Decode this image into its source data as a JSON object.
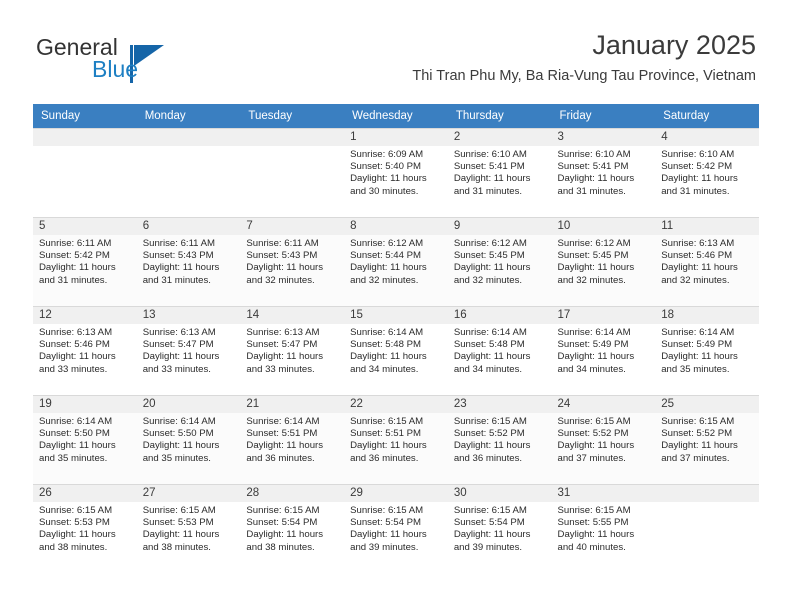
{
  "brand": {
    "name_part1": "General",
    "name_part2": "Blue",
    "logo_icon": "triangle-flag-icon"
  },
  "header": {
    "month_title": "January 2025",
    "location": "Thi Tran Phu My, Ba Ria-Vung Tau Province, Vietnam"
  },
  "theme": {
    "header_bg": "#3a7fc1",
    "header_text": "#ffffff",
    "daynum_band_bg": "#f0f0f0",
    "row_alt_bg": "#fbfbfb",
    "grid_line": "#d9d9d9",
    "brand_blue": "#1d7fc3"
  },
  "calendar": {
    "weekday_headers": [
      "Sunday",
      "Monday",
      "Tuesday",
      "Wednesday",
      "Thursday",
      "Friday",
      "Saturday"
    ],
    "weeks": [
      [
        {
          "day": "",
          "lines": []
        },
        {
          "day": "",
          "lines": []
        },
        {
          "day": "",
          "lines": []
        },
        {
          "day": "1",
          "lines": [
            "Sunrise: 6:09 AM",
            "Sunset: 5:40 PM",
            "Daylight: 11 hours",
            "and 30 minutes."
          ]
        },
        {
          "day": "2",
          "lines": [
            "Sunrise: 6:10 AM",
            "Sunset: 5:41 PM",
            "Daylight: 11 hours",
            "and 31 minutes."
          ]
        },
        {
          "day": "3",
          "lines": [
            "Sunrise: 6:10 AM",
            "Sunset: 5:41 PM",
            "Daylight: 11 hours",
            "and 31 minutes."
          ]
        },
        {
          "day": "4",
          "lines": [
            "Sunrise: 6:10 AM",
            "Sunset: 5:42 PM",
            "Daylight: 11 hours",
            "and 31 minutes."
          ]
        }
      ],
      [
        {
          "day": "5",
          "lines": [
            "Sunrise: 6:11 AM",
            "Sunset: 5:42 PM",
            "Daylight: 11 hours",
            "and 31 minutes."
          ]
        },
        {
          "day": "6",
          "lines": [
            "Sunrise: 6:11 AM",
            "Sunset: 5:43 PM",
            "Daylight: 11 hours",
            "and 31 minutes."
          ]
        },
        {
          "day": "7",
          "lines": [
            "Sunrise: 6:11 AM",
            "Sunset: 5:43 PM",
            "Daylight: 11 hours",
            "and 32 minutes."
          ]
        },
        {
          "day": "8",
          "lines": [
            "Sunrise: 6:12 AM",
            "Sunset: 5:44 PM",
            "Daylight: 11 hours",
            "and 32 minutes."
          ]
        },
        {
          "day": "9",
          "lines": [
            "Sunrise: 6:12 AM",
            "Sunset: 5:45 PM",
            "Daylight: 11 hours",
            "and 32 minutes."
          ]
        },
        {
          "day": "10",
          "lines": [
            "Sunrise: 6:12 AM",
            "Sunset: 5:45 PM",
            "Daylight: 11 hours",
            "and 32 minutes."
          ]
        },
        {
          "day": "11",
          "lines": [
            "Sunrise: 6:13 AM",
            "Sunset: 5:46 PM",
            "Daylight: 11 hours",
            "and 32 minutes."
          ]
        }
      ],
      [
        {
          "day": "12",
          "lines": [
            "Sunrise: 6:13 AM",
            "Sunset: 5:46 PM",
            "Daylight: 11 hours",
            "and 33 minutes."
          ]
        },
        {
          "day": "13",
          "lines": [
            "Sunrise: 6:13 AM",
            "Sunset: 5:47 PM",
            "Daylight: 11 hours",
            "and 33 minutes."
          ]
        },
        {
          "day": "14",
          "lines": [
            "Sunrise: 6:13 AM",
            "Sunset: 5:47 PM",
            "Daylight: 11 hours",
            "and 33 minutes."
          ]
        },
        {
          "day": "15",
          "lines": [
            "Sunrise: 6:14 AM",
            "Sunset: 5:48 PM",
            "Daylight: 11 hours",
            "and 34 minutes."
          ]
        },
        {
          "day": "16",
          "lines": [
            "Sunrise: 6:14 AM",
            "Sunset: 5:48 PM",
            "Daylight: 11 hours",
            "and 34 minutes."
          ]
        },
        {
          "day": "17",
          "lines": [
            "Sunrise: 6:14 AM",
            "Sunset: 5:49 PM",
            "Daylight: 11 hours",
            "and 34 minutes."
          ]
        },
        {
          "day": "18",
          "lines": [
            "Sunrise: 6:14 AM",
            "Sunset: 5:49 PM",
            "Daylight: 11 hours",
            "and 35 minutes."
          ]
        }
      ],
      [
        {
          "day": "19",
          "lines": [
            "Sunrise: 6:14 AM",
            "Sunset: 5:50 PM",
            "Daylight: 11 hours",
            "and 35 minutes."
          ]
        },
        {
          "day": "20",
          "lines": [
            "Sunrise: 6:14 AM",
            "Sunset: 5:50 PM",
            "Daylight: 11 hours",
            "and 35 minutes."
          ]
        },
        {
          "day": "21",
          "lines": [
            "Sunrise: 6:14 AM",
            "Sunset: 5:51 PM",
            "Daylight: 11 hours",
            "and 36 minutes."
          ]
        },
        {
          "day": "22",
          "lines": [
            "Sunrise: 6:15 AM",
            "Sunset: 5:51 PM",
            "Daylight: 11 hours",
            "and 36 minutes."
          ]
        },
        {
          "day": "23",
          "lines": [
            "Sunrise: 6:15 AM",
            "Sunset: 5:52 PM",
            "Daylight: 11 hours",
            "and 36 minutes."
          ]
        },
        {
          "day": "24",
          "lines": [
            "Sunrise: 6:15 AM",
            "Sunset: 5:52 PM",
            "Daylight: 11 hours",
            "and 37 minutes."
          ]
        },
        {
          "day": "25",
          "lines": [
            "Sunrise: 6:15 AM",
            "Sunset: 5:52 PM",
            "Daylight: 11 hours",
            "and 37 minutes."
          ]
        }
      ],
      [
        {
          "day": "26",
          "lines": [
            "Sunrise: 6:15 AM",
            "Sunset: 5:53 PM",
            "Daylight: 11 hours",
            "and 38 minutes."
          ]
        },
        {
          "day": "27",
          "lines": [
            "Sunrise: 6:15 AM",
            "Sunset: 5:53 PM",
            "Daylight: 11 hours",
            "and 38 minutes."
          ]
        },
        {
          "day": "28",
          "lines": [
            "Sunrise: 6:15 AM",
            "Sunset: 5:54 PM",
            "Daylight: 11 hours",
            "and 38 minutes."
          ]
        },
        {
          "day": "29",
          "lines": [
            "Sunrise: 6:15 AM",
            "Sunset: 5:54 PM",
            "Daylight: 11 hours",
            "and 39 minutes."
          ]
        },
        {
          "day": "30",
          "lines": [
            "Sunrise: 6:15 AM",
            "Sunset: 5:54 PM",
            "Daylight: 11 hours",
            "and 39 minutes."
          ]
        },
        {
          "day": "31",
          "lines": [
            "Sunrise: 6:15 AM",
            "Sunset: 5:55 PM",
            "Daylight: 11 hours",
            "and 40 minutes."
          ]
        },
        {
          "day": "",
          "lines": []
        }
      ]
    ]
  }
}
